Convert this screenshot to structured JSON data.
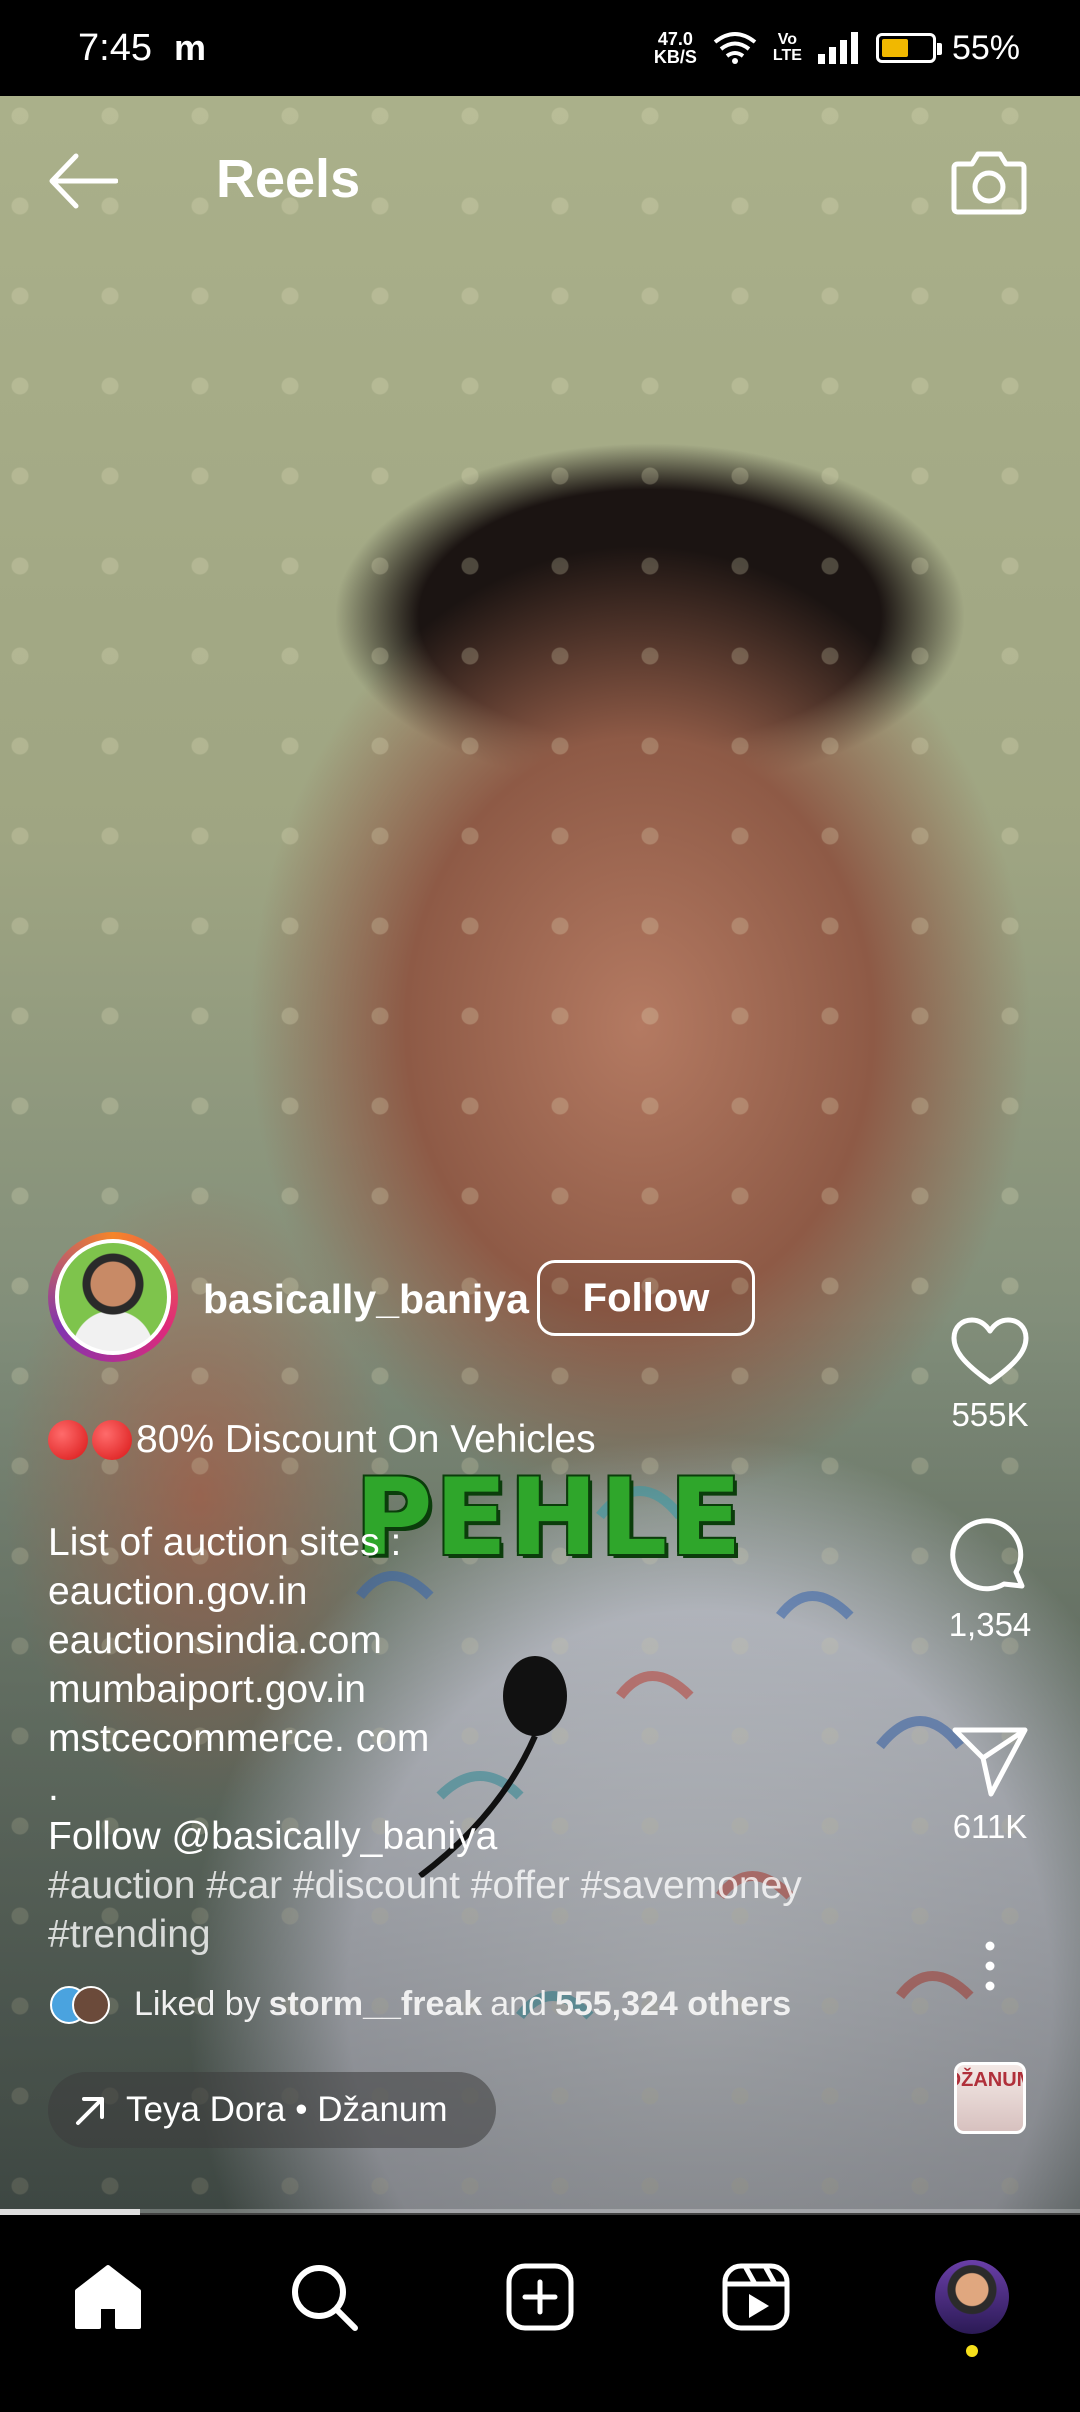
{
  "status_bar": {
    "time": "7:45",
    "app_indicator": "m",
    "net_speed_value": "47.0",
    "net_speed_unit": "KB/S",
    "volte_top": "Vo",
    "volte_bottom": "LTE",
    "battery_percent": "55%",
    "battery_level": 0.55
  },
  "header": {
    "title": "Reels",
    "back_icon": "arrow-left-icon",
    "camera_icon": "camera-icon"
  },
  "overlay": {
    "video_text": "PEHLE"
  },
  "author": {
    "username": "basically_baniya",
    "follow_label": "Follow"
  },
  "caption": {
    "title": "80% Discount On Vehicles",
    "lines": [
      "List of auction sites :",
      "eauction.gov.in",
      "eauctionsindia.com",
      "mumbaiport.gov.in",
      "mstcecommerce. com",
      ".",
      "Follow @basically_baniya"
    ],
    "hashtags": [
      "#auction #car #discount #offer #savemoney",
      "#trending"
    ]
  },
  "liked_by": {
    "prefix": "Liked by",
    "user": "storm__freak",
    "middle": "and",
    "others": "555,324 others"
  },
  "music": {
    "label": "Teya Dora • Džanum",
    "icon": "arrow-up-right-icon"
  },
  "actions": {
    "likes": "555K",
    "comments": "1,354",
    "shares": "611K",
    "audio_thumb_text": "DŽANUM"
  },
  "video": {
    "progress": 0.13
  },
  "bottom_nav": {
    "items": [
      "home-icon",
      "search-icon",
      "create-icon",
      "reels-icon",
      "profile-avatar"
    ]
  }
}
